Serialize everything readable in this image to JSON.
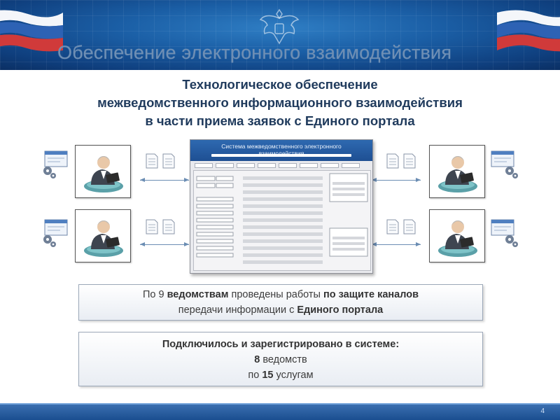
{
  "slide": {
    "title": "Обеспечение электронного взаимодействия",
    "subtitle_lines": [
      "Технологическое обеспечение",
      "межведомственного информационного взаимодействия",
      "в части приема заявок с Единого портала"
    ],
    "page_number": "4"
  },
  "diagram": {
    "portal_title_lines": [
      "Система межведомственного электронного",
      "взаимодействия"
    ]
  },
  "info_box_1": {
    "line1": {
      "p1": "По ",
      "n": "9",
      "p2": " ведомствам",
      "p3": " проведены работы ",
      "p4": "по защите каналов"
    },
    "line2": {
      "p1": "передачи информации с ",
      "p2": "Единого портала"
    }
  },
  "info_box_2": {
    "heading": "Подключилось и зарегистрировано в системе:",
    "line1": {
      "n": "8",
      "text": " ведомств"
    },
    "line2": {
      "pre": "по ",
      "n": "15",
      "text": " услугам"
    }
  },
  "colors": {
    "header_blue": "#1b5fa6",
    "title_text": "#6f8fb4",
    "subtitle_text": "#1f3a5c",
    "footer_blue": "#1a4e90"
  },
  "icons": [
    "flag-icon",
    "emblem-icon",
    "official-icon",
    "gear-icon",
    "document-icon",
    "screen-icon"
  ]
}
